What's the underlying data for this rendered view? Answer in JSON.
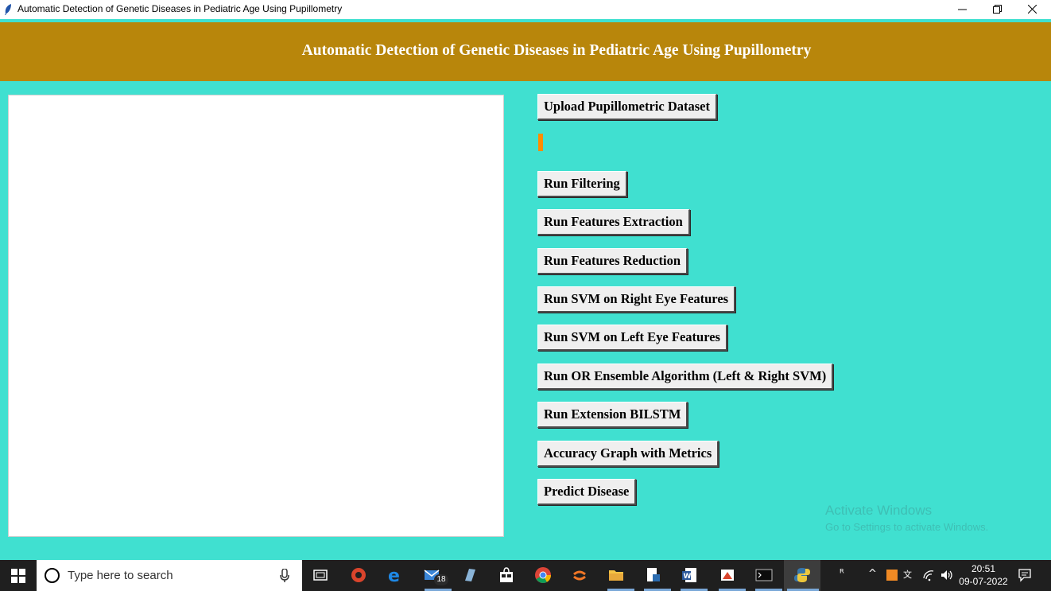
{
  "window": {
    "title": "Automatic Detection of Genetic Diseases in Pediatric Age Using Pupillometry"
  },
  "header": {
    "heading": "Automatic Detection of Genetic Diseases in Pediatric Age Using Pupillometry"
  },
  "buttons": {
    "upload": "Upload Pupillometric Dataset",
    "filtering": "Run Filtering",
    "features_extraction": "Run Features Extraction",
    "features_reduction": "Run Features Reduction",
    "svm_right": "Run SVM on Right Eye Features",
    "svm_left": "Run SVM on Left Eye Features",
    "ensemble": "Run OR Ensemble Algorithm (Left & Right SVM)",
    "bilstm": "Run Extension BILSTM",
    "accuracy_graph": "Accuracy Graph with Metrics",
    "predict": "Predict Disease"
  },
  "output_text": "",
  "watermark": {
    "line1": "Activate Windows",
    "line2": "Go to Settings to activate Windows."
  },
  "taskbar": {
    "search_placeholder": "Type here to search",
    "mail_badge": "18",
    "time": "20:51",
    "date": "09-07-2022"
  },
  "colors": {
    "background": "#40e0d0",
    "header": "#b8860b",
    "button": "#efefef",
    "accent_mark": "#ff8c00",
    "taskbar": "#1f1f1f"
  },
  "icons": [
    "feather-icon",
    "minimize-icon",
    "restore-icon",
    "close-icon",
    "windows-start-icon",
    "search-circle-icon",
    "microphone-icon",
    "task-view-icon",
    "mail-icon",
    "chrome-icon",
    "edge-icon",
    "file-explorer-icon",
    "word-icon",
    "terminal-icon",
    "python-icon"
  ]
}
